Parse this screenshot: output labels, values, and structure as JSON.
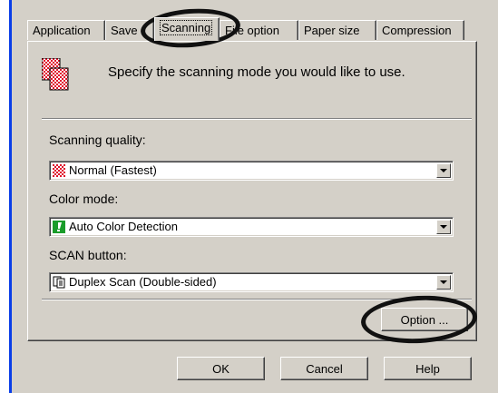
{
  "tabs": [
    {
      "label": "Application",
      "active": false
    },
    {
      "label": "Save",
      "active": false
    },
    {
      "label": "Scanning",
      "active": true
    },
    {
      "label": "File option",
      "active": false
    },
    {
      "label": "Paper size",
      "active": false
    },
    {
      "label": "Compression",
      "active": false
    }
  ],
  "header": {
    "text": "Specify the scanning mode you would like to use.",
    "icon": "checkered-pages-icon"
  },
  "scanning_quality": {
    "label": "Scanning quality:",
    "value": "Normal (Fastest)",
    "icon": "red-checker-icon"
  },
  "color_mode": {
    "label": "Color mode:",
    "value": "Auto Color Detection",
    "icon": "green-exclamation-icon"
  },
  "scan_button": {
    "label": "SCAN button:",
    "value": "Duplex Scan (Double-sided)",
    "icon": "duplex-document-icon"
  },
  "option_button": {
    "label": "Option ..."
  },
  "footer": {
    "ok": "OK",
    "cancel": "Cancel",
    "help": "Help"
  },
  "colors": {
    "annotation": "#111111",
    "accent_blue": "#0a3ee8",
    "dialog_gray": "#d4d0c8"
  }
}
